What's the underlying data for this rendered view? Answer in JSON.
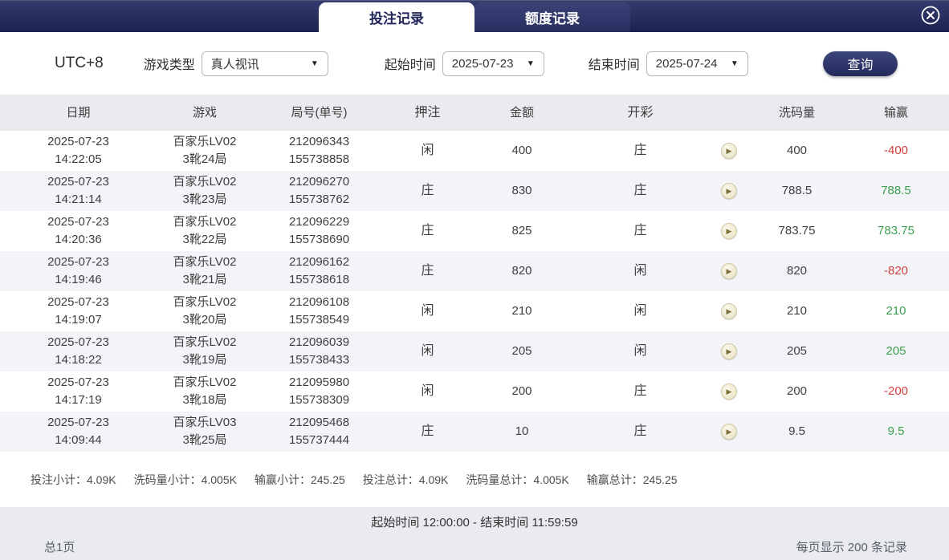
{
  "colors": {
    "navy": "#20265a",
    "header_gray": "#e9ebef",
    "row_alt": "#f3f4f8",
    "loss_red": "#d43f3f",
    "win_green": "#3d9e4f"
  },
  "icons": {
    "dropdown_arrow": "▼",
    "play": "▶"
  },
  "tabs": [
    {
      "label": "投注记录",
      "active": true
    },
    {
      "label": "额度记录",
      "active": false
    }
  ],
  "filters": {
    "timezone": "UTC+8",
    "game_type_label": "游戏类型",
    "game_type_value": "真人视讯",
    "start_label": "起始时间",
    "start_value": "2025-07-23",
    "end_label": "结束时间",
    "end_value": "2025-07-24",
    "query_label": "查询"
  },
  "table": {
    "headers": [
      "日期",
      "游戏",
      "局号(单号)",
      "押注",
      "金额",
      "开彩",
      "",
      "洗码量",
      "输赢"
    ],
    "rows": [
      {
        "date": "2025-07-23",
        "time": "14:22:05",
        "game": "百家乐LV02",
        "round": "3靴24局",
        "num1": "212096343",
        "num2": "155738858",
        "bet": "闲",
        "amount": "400",
        "result": "庄",
        "wash": "400",
        "winloss": "-400",
        "wl_type": "loss"
      },
      {
        "date": "2025-07-23",
        "time": "14:21:14",
        "game": "百家乐LV02",
        "round": "3靴23局",
        "num1": "212096270",
        "num2": "155738762",
        "bet": "庄",
        "amount": "830",
        "result": "庄",
        "wash": "788.5",
        "winloss": "788.5",
        "wl_type": "win"
      },
      {
        "date": "2025-07-23",
        "time": "14:20:36",
        "game": "百家乐LV02",
        "round": "3靴22局",
        "num1": "212096229",
        "num2": "155738690",
        "bet": "庄",
        "amount": "825",
        "result": "庄",
        "wash": "783.75",
        "winloss": "783.75",
        "wl_type": "win"
      },
      {
        "date": "2025-07-23",
        "time": "14:19:46",
        "game": "百家乐LV02",
        "round": "3靴21局",
        "num1": "212096162",
        "num2": "155738618",
        "bet": "庄",
        "amount": "820",
        "result": "闲",
        "wash": "820",
        "winloss": "-820",
        "wl_type": "loss"
      },
      {
        "date": "2025-07-23",
        "time": "14:19:07",
        "game": "百家乐LV02",
        "round": "3靴20局",
        "num1": "212096108",
        "num2": "155738549",
        "bet": "闲",
        "amount": "210",
        "result": "闲",
        "wash": "210",
        "winloss": "210",
        "wl_type": "win"
      },
      {
        "date": "2025-07-23",
        "time": "14:18:22",
        "game": "百家乐LV02",
        "round": "3靴19局",
        "num1": "212096039",
        "num2": "155738433",
        "bet": "闲",
        "amount": "205",
        "result": "闲",
        "wash": "205",
        "winloss": "205",
        "wl_type": "win"
      },
      {
        "date": "2025-07-23",
        "time": "14:17:19",
        "game": "百家乐LV02",
        "round": "3靴18局",
        "num1": "212095980",
        "num2": "155738309",
        "bet": "闲",
        "amount": "200",
        "result": "庄",
        "wash": "200",
        "winloss": "-200",
        "wl_type": "loss"
      },
      {
        "date": "2025-07-23",
        "time": "14:09:44",
        "game": "百家乐LV03",
        "round": "3靴25局",
        "num1": "212095468",
        "num2": "155737444",
        "bet": "庄",
        "amount": "10",
        "result": "庄",
        "wash": "9.5",
        "winloss": "9.5",
        "wl_type": "win"
      }
    ]
  },
  "summary": [
    {
      "label": "投注小计：",
      "value": "4.09K"
    },
    {
      "label": "洗码量小计：",
      "value": "4.005K"
    },
    {
      "label": "输赢小计：",
      "value": "245.25"
    },
    {
      "label": "投注总计：",
      "value": "4.09K"
    },
    {
      "label": "洗码量总计：",
      "value": "4.005K"
    },
    {
      "label": "输赢总计：",
      "value": "245.25"
    }
  ],
  "footer": {
    "time_range": "起始时间 12:00:00 - 结束时间 11:59:59",
    "page_info": "总1页",
    "per_page": "每页显示 200 条记录"
  }
}
